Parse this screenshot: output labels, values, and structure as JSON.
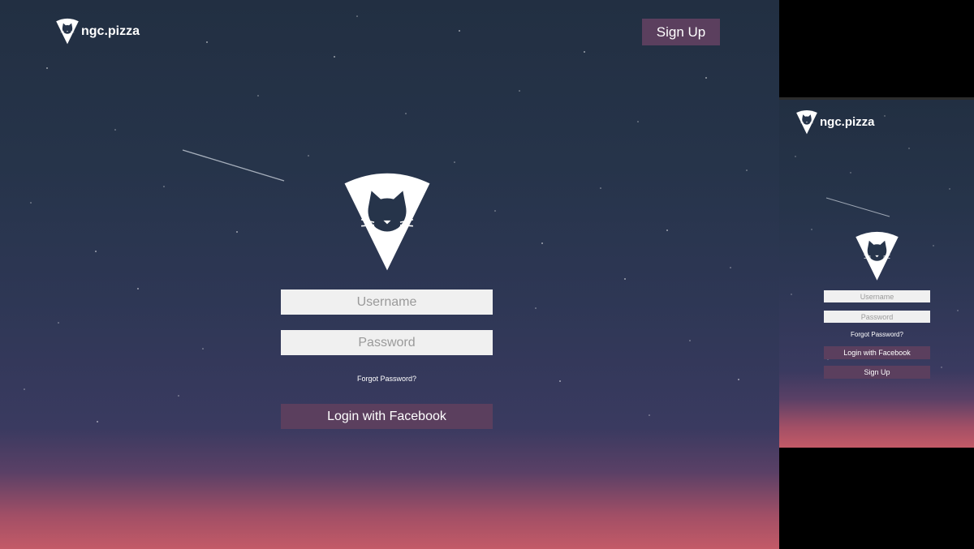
{
  "desktop": {
    "brand": {
      "name": "ngc.pizza"
    },
    "header": {
      "signup_label": "Sign Up"
    },
    "form": {
      "username_placeholder": "Username",
      "password_placeholder": "Password",
      "forgot_label": "Forgot Password?",
      "facebook_label": "Login with Facebook"
    }
  },
  "mobile": {
    "brand": {
      "name": "ngc.pizza"
    },
    "form": {
      "username_placeholder": "Username",
      "password_placeholder": "Password",
      "forgot_label": "Forgot Password?",
      "facebook_label": "Login with Facebook",
      "signup_label": "Sign Up"
    }
  },
  "icons": {
    "logo": "pizza-cat-logo-icon",
    "mascot": "pizza-cat-mascot-icon"
  },
  "colors": {
    "sky_top": "#222f42",
    "sky_bottom": "#c35a67",
    "button": "#5b3f5e",
    "field": "#f0f0f0",
    "text": "#ffffff"
  }
}
